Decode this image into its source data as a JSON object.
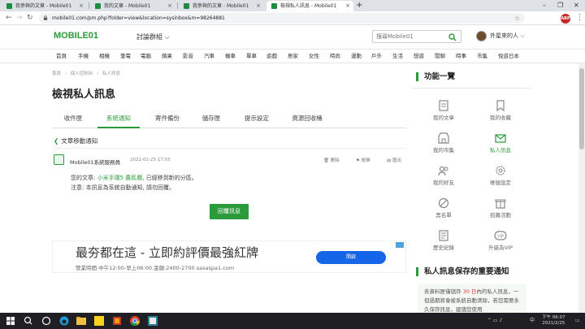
{
  "browser": {
    "tabs": [
      {
        "label": "我參與的文章 - Mobile01"
      },
      {
        "label": "我的文章 - Mobile01"
      },
      {
        "label": "我參與的文章 - Mobile01"
      },
      {
        "label": "檢視私人訊息 - Mobile01"
      }
    ],
    "url": "mobile01.com/pm.php?folder=view&location=sysinbox&m=98264881",
    "new_tab": "+",
    "abp_label": "ABP"
  },
  "site": {
    "logo": "MOBILE01",
    "forum_select": "討論群組 ⌵",
    "search_placeholder": "搜尋Mobile01",
    "username": "外星來的人 ⌵",
    "categories": [
      "首頁",
      "手機",
      "相機",
      "筆電",
      "電腦",
      "蘋果",
      "影音",
      "汽車",
      "機車",
      "單車",
      "遊戲",
      "居家",
      "女性",
      "時尚",
      "運動",
      "戶外",
      "生活",
      "想遊",
      "閒聊",
      "時事",
      "市集",
      "悅遊日本"
    ]
  },
  "breadcrumb": [
    "首頁",
    "›",
    "個人控制台",
    "›",
    "私人訊息"
  ],
  "page_title": "檢視私人訊息",
  "pm_tabs": [
    "收件匣",
    "系統通知",
    "寄件備份",
    "儲存匣",
    "提示設定",
    "資源回收桶"
  ],
  "message": {
    "heading": "文章移動通知",
    "sender": "Mobile01系統服務員",
    "date": "2021-02-25 17:55",
    "actions": {
      "delete": "刪除",
      "report": "檢舉",
      "print": "匯出"
    },
    "line1_prefix": "您的文章:",
    "line1_link": "小米手環5 農民曆",
    "line1_suffix": ", 已經移到新的分區。",
    "line2": "注意: 本訊息為系統自動通知, 請勿回覆。",
    "reply_button": "回覆訊息"
  },
  "ad": {
    "title": "最夯都在這 - 立即約評價最強紅牌",
    "subtitle": "營業時間:中午12:00-早上06:00.金額:2400-2700 sasaspa1.com",
    "cta": "開啟"
  },
  "sidebar": {
    "title": "功能一覽",
    "items": [
      {
        "label": "我的文章",
        "icon": "article-icon"
      },
      {
        "label": "我的收藏",
        "icon": "bookmark-icon"
      },
      {
        "label": "我的市集",
        "icon": "shop-icon"
      },
      {
        "label": "私人訊息",
        "icon": "mail-icon"
      },
      {
        "label": "我的好友",
        "icon": "friends-icon"
      },
      {
        "label": "帳號設定",
        "icon": "settings-icon"
      },
      {
        "label": "黑名單",
        "icon": "block-icon"
      },
      {
        "label": "招募活動",
        "icon": "gift-icon"
      },
      {
        "label": "歷史紀錄",
        "icon": "history-icon"
      },
      {
        "label": "升級為VIP",
        "icon": "vip-icon"
      }
    ],
    "notice_title": "私人訊息保存的重要通知",
    "notice_text_prefix": "各資料匣僅儲存",
    "notice_days": "30 日",
    "notice_text_suffix": "內的私人訊息，一但過期將會被系統自動清除，若您需要永久保存訊息，建議您使用"
  },
  "taskbar": {
    "lang": "中",
    "time": "下午 06:07",
    "date": "2021/2/25"
  },
  "colors": {
    "brand": "#2b9a3b",
    "ad_button": "#1565e8"
  }
}
